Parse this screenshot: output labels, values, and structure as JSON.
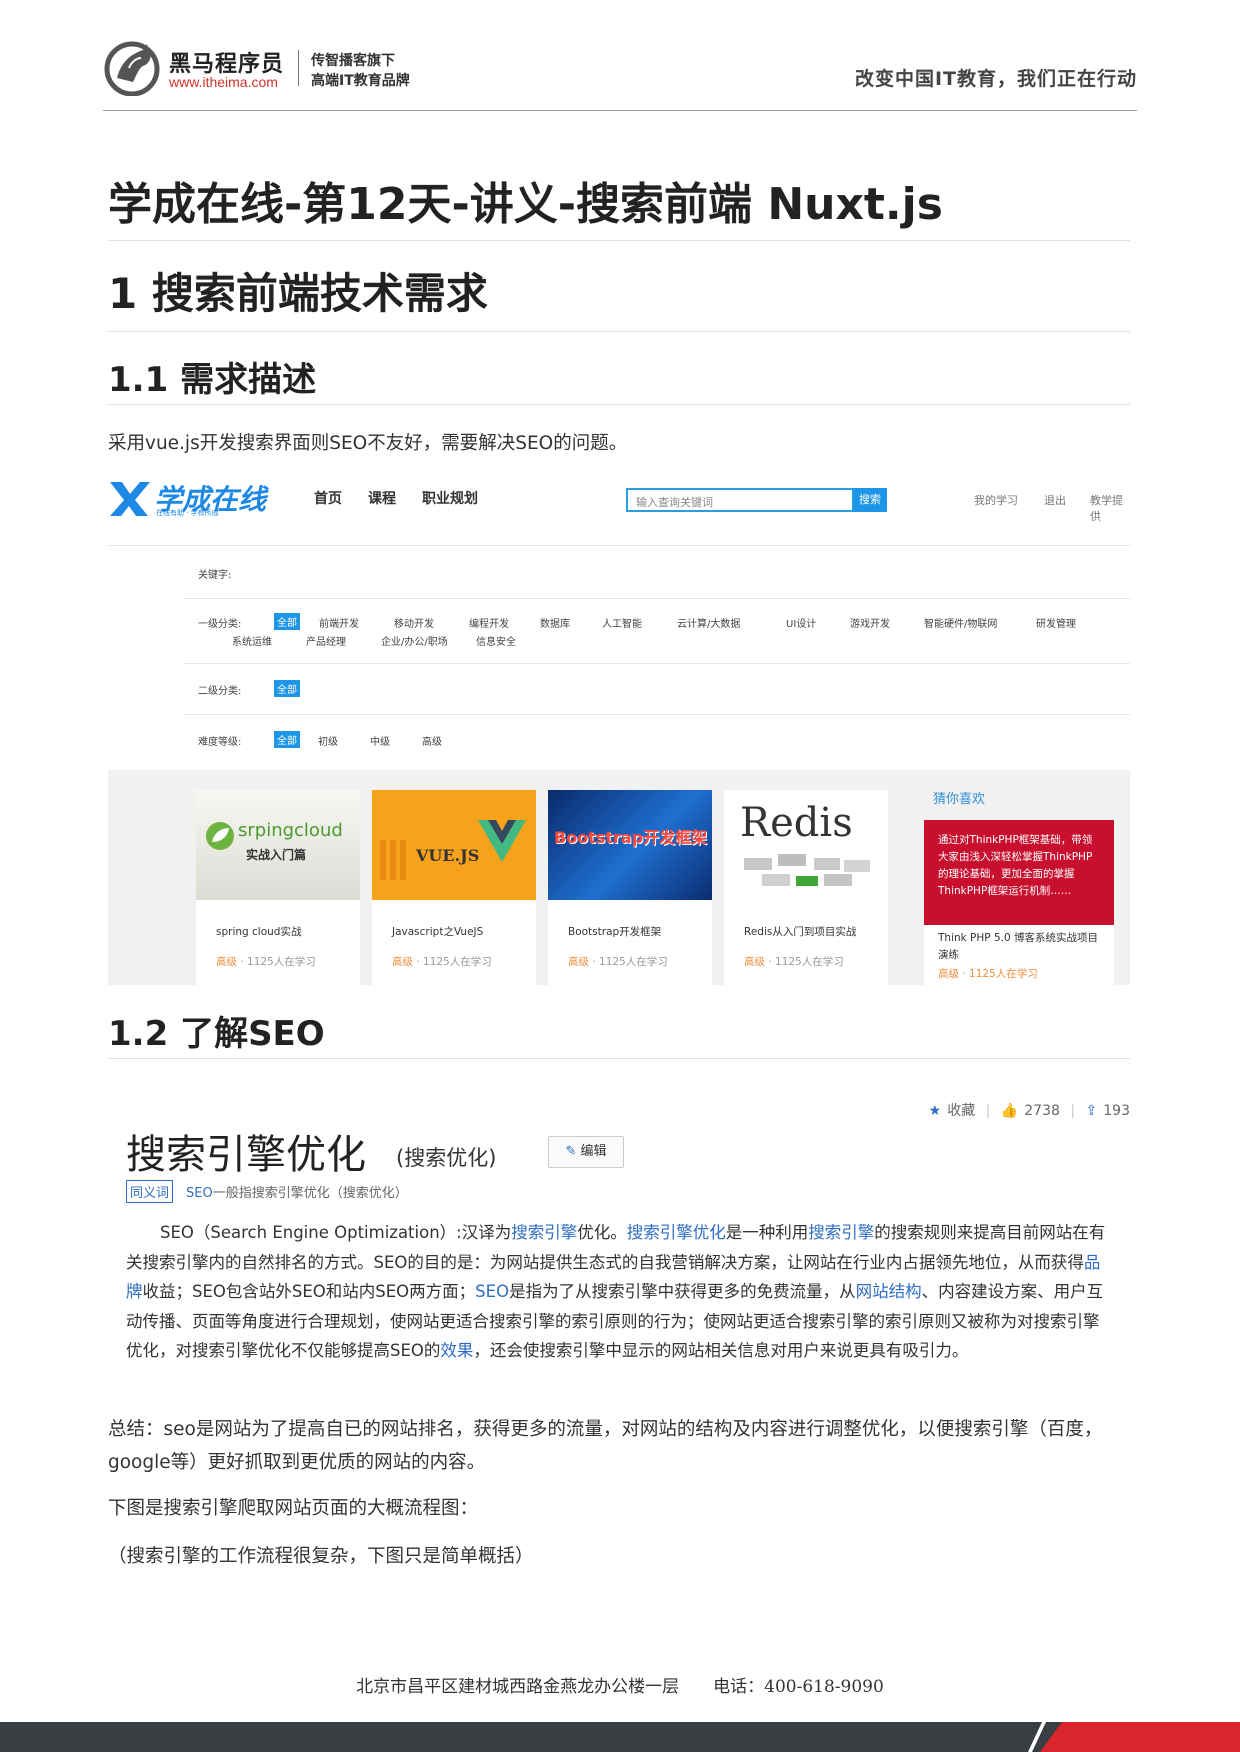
{
  "header": {
    "brand_name": "黑马程序员",
    "brand_url": "www.itheima.com",
    "tagline_1": "传智播客旗下",
    "tagline_2": "高端IT教育品牌",
    "slogan": "改变中国IT教育，我们正在行动"
  },
  "doc_title": "学成在线-第12天-讲义-搜索前端 Nuxt.js",
  "section1": {
    "title": "1 搜索前端技术需求",
    "sub1_title": "1.1 需求描述",
    "sub1_text": "采用vue.js开发搜索界面则SEO不友好，需要解决SEO的问题。",
    "sub2_title": "1.2 了解SEO"
  },
  "xc_screenshot": {
    "logo_text": "学成在线",
    "logo_sub": "在线有助 · 学有所成",
    "nav": [
      "首页",
      "课程",
      "职业规划"
    ],
    "search_placeholder": "输入查询关键词",
    "search_button": "搜索",
    "right_links": [
      "我的学习",
      "退出",
      "教学提供"
    ],
    "keyword_label": "关键字:",
    "level1_label": "一级分类:",
    "level1_row1": [
      "全部",
      "前端开发",
      "移动开发",
      "编程开发",
      "数据库",
      "人工智能",
      "云计算/大数据",
      "UI设计",
      "游戏开发",
      "智能硬件/物联网",
      "研发管理"
    ],
    "level1_row2": [
      "系统运维",
      "产品经理",
      "企业/办公/职场",
      "信息安全"
    ],
    "level2_label": "二级分类:",
    "level2_all": "全部",
    "difficulty_label": "难度等级:",
    "difficulty": [
      "全部",
      "初级",
      "中级",
      "高级"
    ],
    "courses": [
      {
        "title": "spring cloud实战",
        "level": "高级",
        "learners": "· 1125人在学习",
        "img_text": "srpingcloud",
        "img_sub": "实战入门篇"
      },
      {
        "title": "Javascript之VueJS",
        "level": "高级",
        "learners": "· 1125人在学习",
        "img_text": "VUE.JS"
      },
      {
        "title": "Bootstrap开发框架",
        "level": "高级",
        "learners": "· 1125人在学习",
        "img_text": "Bootstrap开发框架"
      },
      {
        "title": "Redis从入门到项目实战",
        "level": "高级",
        "learners": "· 1125人在学习",
        "img_text": "Redis"
      }
    ],
    "guess_title": "猜你喜欢",
    "guess_img_text": "通过对ThinkPHP框架基础，带领大家由浅入深轻松掌握ThinkPHP的理论基础，更加全面的掌握ThinkPHP框架运行机制……",
    "guess_card_title": "Think PHP 5.0 博客系统实战项目演练",
    "guess_meta": "高级 · 1125人在学习"
  },
  "baike": {
    "fav": "收藏",
    "likes": "2738",
    "shares": "193",
    "title": "搜索引擎优化",
    "subtitle": "(搜索优化)",
    "edit": "编辑",
    "synonym_tag": "同义词",
    "synonym_link": "SEO",
    "synonym_rest": "一般指搜索引擎优化（搜索优化）",
    "body": [
      {
        "t": "SEO（Search Engine Optimization）:汉译为"
      },
      {
        "t": "搜索引擎",
        "link": true
      },
      {
        "t": "优化。"
      },
      {
        "t": "搜索引擎优化",
        "link": true
      },
      {
        "t": "是一种利用"
      },
      {
        "t": "搜索引擎",
        "link": true
      },
      {
        "t": "的搜索规则来提高目前网站在有关搜索引擎内的自然排名的方式。SEO的目的是：为网站提供生态式的自我营销解决方案，让网站在行业内占据领先地位，从而获得"
      },
      {
        "t": "品牌",
        "link": true
      },
      {
        "t": "收益；SEO包含站外SEO和站内SEO两方面；"
      },
      {
        "t": "SEO",
        "link": true
      },
      {
        "t": "是指为了从搜索引擎中获得更多的免费流量，从"
      },
      {
        "t": "网站结构",
        "link": true
      },
      {
        "t": "、内容建设方案、用户互动传播、页面等角度进行合理规划，使网站更适合搜索引擎的索引原则的行为；使网站更适合搜索引擎的索引原则又被称为对搜索引擎优化，对搜索引擎优化不仅能够提高SEO的"
      },
      {
        "t": "效果",
        "link": true
      },
      {
        "t": "，还会使搜索引擎中显示的网站相关信息对用户来说更具有吸引力。"
      }
    ]
  },
  "summary": {
    "text1": "总结：seo是网站为了提高自已的网站排名，获得更多的流量，对网站的结构及内容进行调整优化，以便搜索引擎（百度，google等）更好抓取到更优质的网站的内容。",
    "text2": "下图是搜索引擎爬取网站页面的大概流程图：",
    "text3": "（搜索引擎的工作流程很复杂，下图只是简单概括）"
  },
  "footer": {
    "address": "北京市昌平区建材城西路金燕龙办公楼一层　　电话：400-618-9090"
  }
}
